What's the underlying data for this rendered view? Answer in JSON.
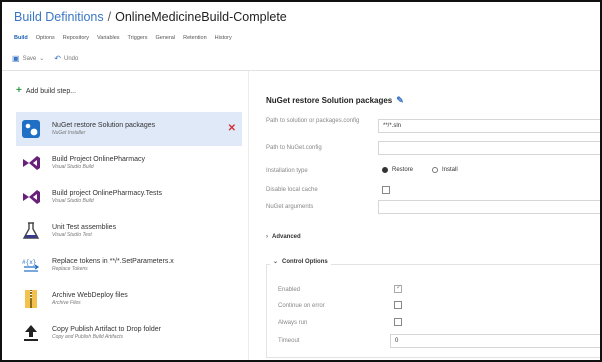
{
  "header": {
    "breadcrumb_root": "Build Definitions",
    "separator": "/",
    "definition_name": "OnlineMedicineBuild-Complete"
  },
  "tabs": [
    "Build",
    "Options",
    "Repository",
    "Variables",
    "Triggers",
    "General",
    "Retention",
    "History"
  ],
  "toolbar": {
    "save_label": "Save",
    "undo_label": "Undo"
  },
  "steps_panel": {
    "add_step_label": "Add build step...",
    "steps": [
      {
        "name": "NuGet restore Solution packages",
        "subtitle": "NuGet Installer",
        "icon": "nuget-icon",
        "selected": true
      },
      {
        "name": "Build Project OnlinePharmacy",
        "subtitle": "Visual Studio Build",
        "icon": "visual-studio-icon",
        "selected": false
      },
      {
        "name": "Build project OnlinePharmacy.Tests",
        "subtitle": "Visual Studio Build",
        "icon": "visual-studio-icon",
        "selected": false
      },
      {
        "name": "Unit Test assemblies",
        "subtitle": "Visual Studio Test",
        "icon": "flask-icon",
        "selected": false
      },
      {
        "name": "Replace tokens in **/*.SetParameters.x",
        "subtitle": "Replace Tokens",
        "icon": "replace-tokens-icon",
        "selected": false
      },
      {
        "name": "Archive WebDeploy files",
        "subtitle": "Archive Files",
        "icon": "archive-icon",
        "selected": false
      },
      {
        "name": "Copy Publish Artifact to Drop folder",
        "subtitle": "Copy and Publish Build Artifacts",
        "icon": "upload-arrow-icon",
        "selected": false
      }
    ]
  },
  "details": {
    "title": "NuGet restore Solution packages",
    "path_label": "Path to solution or packages.config",
    "path_value": "**/*.sln",
    "nuget_config_label": "Path to NuGet.config",
    "nuget_config_value": "",
    "installation_type_label": "Installation type",
    "restore_label": "Restore",
    "install_label": "Install",
    "installation_type_value": "Restore",
    "disable_cache_label": "Disable local cache",
    "disable_cache_value": false,
    "nuget_args_label": "NuGet arguments",
    "nuget_args_value": "",
    "advanced_label": "Advanced",
    "control_options_label": "Control Options",
    "enabled_label": "Enabled",
    "enabled_value": true,
    "continue_on_error_label": "Continue on error",
    "continue_on_error_value": false,
    "always_run_label": "Always run",
    "always_run_value": false,
    "timeout_label": "Timeout",
    "timeout_value": "0"
  },
  "colors": {
    "accent": "#3a76c4",
    "selected_row": "#dfe9f8",
    "delete": "#d13438",
    "visual_studio": "#68217a"
  }
}
